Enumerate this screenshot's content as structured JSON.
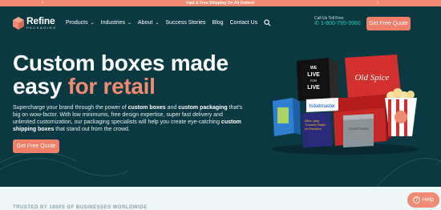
{
  "promo": {
    "text": "Fast & Free Shipping On All Orders!",
    "arrow_left": "‹",
    "arrow_right": "›"
  },
  "logo": {
    "name": "Refine",
    "sub": "PACKAGING"
  },
  "nav": {
    "items": [
      {
        "label": "Products",
        "dropdown": true
      },
      {
        "label": "Industries",
        "dropdown": true
      },
      {
        "label": "About",
        "dropdown": true
      },
      {
        "label": "Success Stories",
        "dropdown": false
      },
      {
        "label": "Blog",
        "dropdown": false
      },
      {
        "label": "Contact Us",
        "dropdown": false
      }
    ]
  },
  "callus": {
    "label": "Call Us Toll Free",
    "phone": "1-800-795-9960"
  },
  "header_button": "Get Free Quote",
  "hero": {
    "headline_1": "Custom boxes made",
    "headline_2": "easy ",
    "headline_accent": "for retail",
    "desc_1": "Supercharge your brand through the power of ",
    "desc_b1": "custom boxes",
    "desc_2": " and ",
    "desc_b2": "custom packaging",
    "desc_3": " that's big on wow-factor. With low minimums, free design expertise, super fast delivery and unlimited customization, our packaging specialists will help you create eye-catching ",
    "desc_b3": "custom shipping boxes",
    "desc_4": " that stand out from the crowd.",
    "button": "Get Free Quote"
  },
  "boxes": {
    "live_box": [
      "WE",
      "LIVE",
      "FOR",
      "LIVE"
    ],
    "brand_box": "Old Spice",
    "ticket_box": "ticketmaster",
    "purple_box": "Alice, play Thunder Radio on Pandora",
    "gray_box": "COURTYARD"
  },
  "trust": {
    "text": "TRUSTED BY 1000S OF BUSINESSES WORLDWIDE"
  },
  "help": {
    "label": "Help",
    "icon": "?"
  },
  "colors": {
    "brand_coral": "#f08a73",
    "hero_bg": "#0a3942",
    "phone_teal": "#1fc5b4"
  }
}
